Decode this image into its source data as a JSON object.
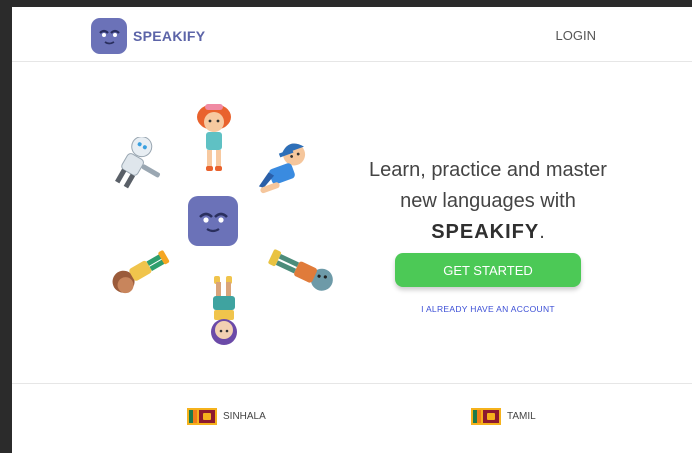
{
  "header": {
    "brand": "SPEAKIFY",
    "login_label": "LOGIN"
  },
  "hero": {
    "line1": "Learn, practice and master",
    "line2": "new languages with",
    "brand": "SPEAKIFY",
    "period": ".",
    "cta_label": "GET STARTED",
    "secondary_label": "I ALREADY HAVE AN ACCOUNT"
  },
  "footer": {
    "languages": [
      {
        "label": "SINHALA",
        "flag": "sri-lanka-flag-icon"
      },
      {
        "label": "TAMIL",
        "flag": "sri-lanka-flag-icon"
      }
    ]
  },
  "colors": {
    "brand": "#6b72b8",
    "cta": "#4cc956",
    "link": "#3c4fd6"
  }
}
